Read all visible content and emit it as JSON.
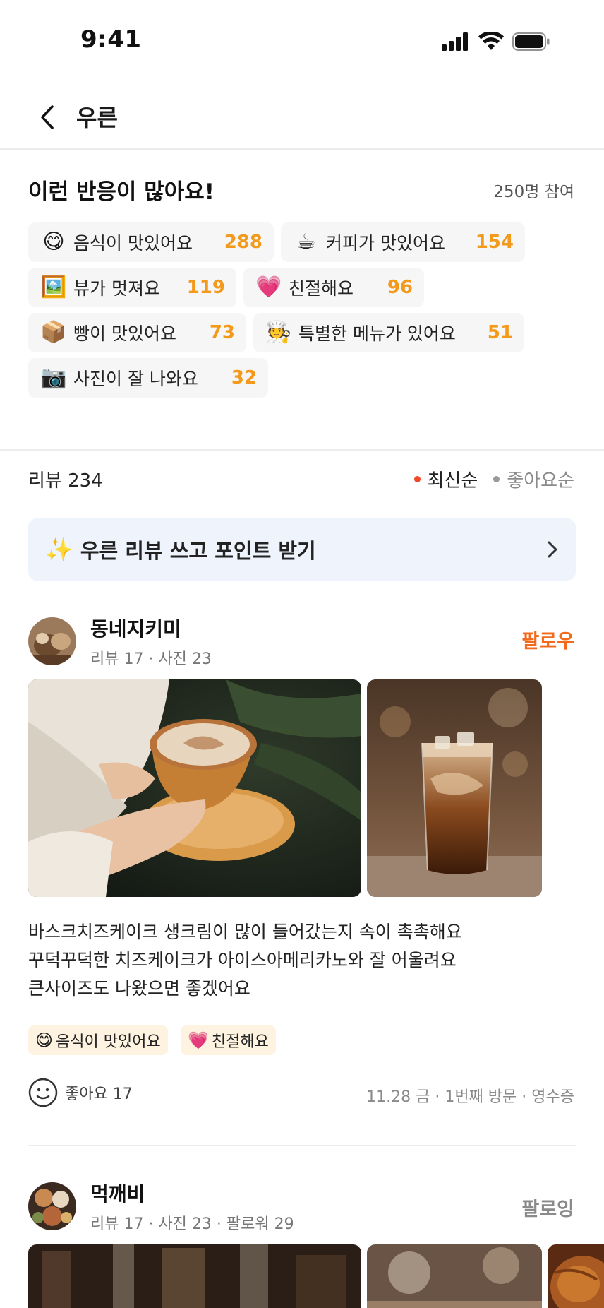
{
  "status_bar": {
    "time": "9:41"
  },
  "header": {
    "title": "우른"
  },
  "reactions": {
    "title": "이런 반응이 많아요!",
    "participants": "250명 참여",
    "chips": [
      {
        "emoji": "😋",
        "label": "음식이 맛있어요",
        "count": "288"
      },
      {
        "emoji": "☕",
        "label": "커피가 맛있어요",
        "count": "154"
      },
      {
        "emoji": "🖼️",
        "label": "뷰가 멋져요",
        "count": "119"
      },
      {
        "emoji": "💗",
        "label": "친절해요",
        "count": "96"
      },
      {
        "emoji": "📦",
        "label": "빵이 맛있어요",
        "count": "73"
      },
      {
        "emoji": "🧑‍🍳",
        "label": "특별한 메뉴가 있어요",
        "count": "51"
      },
      {
        "emoji": "📷",
        "label": "사진이 잘 나와요",
        "count": "32"
      }
    ]
  },
  "reviews_header": {
    "count_label": "리뷰 234",
    "sort_latest": "최신순",
    "sort_likes": "좋아요순"
  },
  "banner": {
    "emoji": "✨",
    "text": "우른 리뷰 쓰고 포인트 받기"
  },
  "review1": {
    "user": "동네지키미",
    "stats": "리뷰 17 · 사진 23",
    "follow": "팔로우",
    "text_lines": [
      "바스크치즈케이크 생크림이 많이 들어갔는지 속이 촉촉해요",
      "꾸덕꾸덕한 치즈케이크가 아이스아메리카노와 잘 어울려요",
      "큰사이즈도 나왔으면 좋겠어요"
    ],
    "tags": [
      {
        "emoji": "😋",
        "label": "음식이 맛있어요"
      },
      {
        "emoji": "💗",
        "label": "친절해요"
      }
    ],
    "likes": "좋아요 17",
    "visit": "11.28 금 · 1번째 방문 · 영수증"
  },
  "review2": {
    "user": "먹깨비",
    "stats": "리뷰 17 · 사진 23 · 팔로워 29",
    "follow": "팔로잉"
  },
  "colors": {
    "accent_orange": "#f26b1d",
    "count_orange": "#f39a1c",
    "sort_active_dot": "#f04a2b",
    "following_gray": "#8a8a8a",
    "banner_bg": "#eef3fc",
    "tag_bg": "#fdf3e0"
  }
}
